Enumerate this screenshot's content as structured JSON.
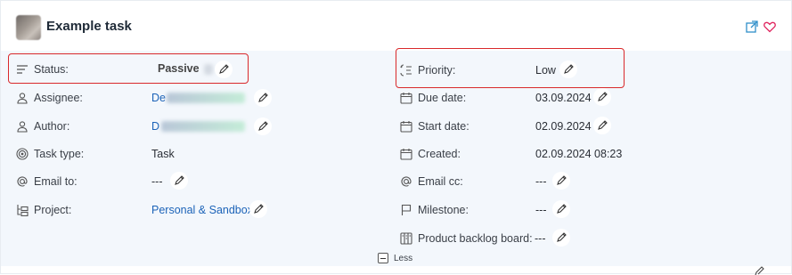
{
  "task": {
    "title": "Example task"
  },
  "left_fields": [
    {
      "label": "Status:",
      "value": "Passive"
    },
    {
      "label": "Assignee:",
      "value": "De"
    },
    {
      "label": "Author:",
      "value": "D"
    },
    {
      "label": "Task type:",
      "value": "Task"
    },
    {
      "label": "Email to:",
      "value": "---"
    },
    {
      "label": "Project:",
      "value": "Personal & Sandbox"
    }
  ],
  "right_fields": [
    {
      "label": "Priority:",
      "value": "Low"
    },
    {
      "label": "Due date:",
      "value": "03.09.2024"
    },
    {
      "label": "Start date:",
      "value": "02.09.2024"
    },
    {
      "label": "Created:",
      "value": "02.09.2024 08:23"
    },
    {
      "label": "Email cc:",
      "value": "---"
    },
    {
      "label": "Milestone:",
      "value": "---"
    },
    {
      "label": "Product backlog board:",
      "value": "---"
    }
  ],
  "toggle": {
    "label": "Less"
  },
  "colors": {
    "highlight": "#d9292b",
    "accent": "#1c63b8",
    "favorite": "#e0245e",
    "panel": "#f3f7fc"
  },
  "icons": [
    "open-external-icon",
    "heart-icon",
    "status-list-icon",
    "user-icon",
    "task-type-icon",
    "at-icon",
    "project-tree-icon",
    "priority-icon",
    "calendar-icon",
    "flag-icon",
    "board-icon",
    "pencil-icon",
    "collapse-icon"
  ]
}
